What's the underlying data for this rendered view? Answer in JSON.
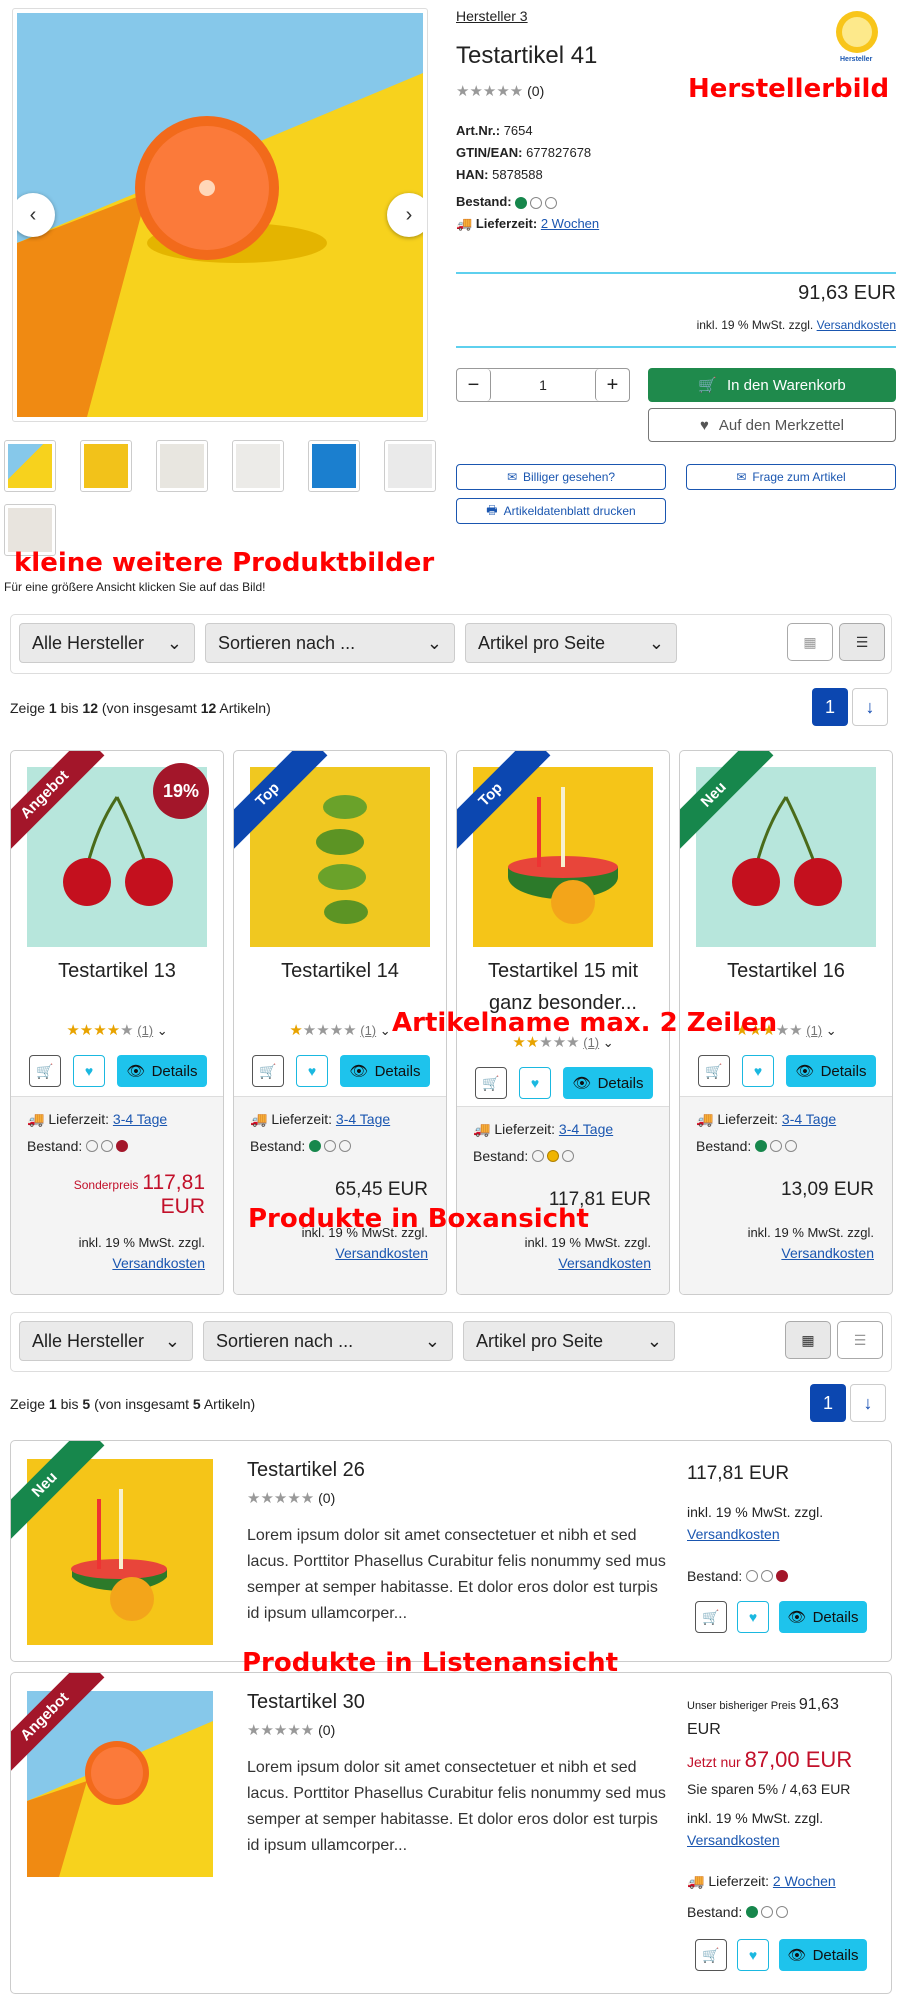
{
  "product": {
    "manufacturer_link": "Hersteller 3",
    "title": "Testartikel 41",
    "rating_count": "(0)",
    "art_nr_label": "Art.Nr.:",
    "art_nr": "7654",
    "gtin_label": "GTIN/EAN:",
    "gtin": "677827678",
    "han_label": "HAN:",
    "han": "5878588",
    "stock_label": "Bestand:",
    "delivery_label": "Lieferzeit:",
    "delivery_value": "2 Wochen",
    "price": "91,63 EUR",
    "tax_note": "inkl. 19 % MwSt. zzgl.",
    "shipping_link": "Versandkosten",
    "quantity": "1",
    "cart_button": "In den Warenkorb",
    "wishlist_button": "Auf den Merkzettel",
    "cheaper_button": "Billiger gesehen?",
    "question_button": "Frage zum Artikel",
    "datasheet_button": "Artikeldatenblatt drucken",
    "manufacturer_logo_text": "Hersteller",
    "enlarge_hint": "Für eine größere Ansicht klicken Sie auf das Bild!"
  },
  "annotations": {
    "manufacturer_image": "Herstellerbild",
    "more_images": "kleine weitere Produktbilder",
    "name_lines": "Artikelname max. 2 Zeilen",
    "box_view": "Produkte in Boxansicht",
    "list_view": "Produkte in Listenansicht"
  },
  "filters": {
    "manufacturer": "Alle Hersteller",
    "sort": "Sortieren nach ...",
    "per_page": "Artikel pro Seite"
  },
  "box_section": {
    "count_prefix": "Zeige ",
    "from": "1",
    "mid": " bis ",
    "to": "12",
    "suffix1": " (von insgesamt ",
    "total": "12",
    "suffix2": " Artikeln)",
    "page": "1"
  },
  "list_section": {
    "count_prefix": "Zeige ",
    "from": "1",
    "mid": " bis ",
    "to": "5",
    "suffix1": " (von insgesamt ",
    "total": "5",
    "suffix2": " Artikeln)",
    "page": "1"
  },
  "box_products": [
    {
      "name": "Testartikel 13",
      "ribbon": "Angebot",
      "badge": "19%",
      "rating_count": "(1)",
      "stars": 4,
      "delivery_label": "Lieferzeit:",
      "delivery": "3-4 Tage",
      "stock_label": "Bestand:",
      "stock": "red",
      "price_prefix": "Sonderpreis",
      "price": "117,81",
      "price_unit": "EUR",
      "tax": "inkl. 19 % MwSt. zzgl.",
      "shipping": "Versandkosten",
      "details": "Details"
    },
    {
      "name": "Testartikel 14",
      "ribbon": "Top",
      "rating_count": "(1)",
      "stars": 1,
      "delivery_label": "Lieferzeit:",
      "delivery": "3-4 Tage",
      "stock_label": "Bestand:",
      "stock": "green",
      "price": "65,45 EUR",
      "tax": "inkl. 19 % MwSt. zzgl.",
      "shipping": "Versandkosten",
      "details": "Details"
    },
    {
      "name": "Testartikel 15 mit ganz besonder...",
      "ribbon": "Top",
      "rating_count": "(1)",
      "stars": 2,
      "delivery_label": "Lieferzeit:",
      "delivery": "3-4 Tage",
      "stock_label": "Bestand:",
      "stock": "yellow",
      "price": "117,81 EUR",
      "tax": "inkl. 19 % MwSt. zzgl.",
      "shipping": "Versandkosten",
      "details": "Details"
    },
    {
      "name": "Testartikel 16",
      "ribbon": "Neu",
      "rating_count": "(1)",
      "stars": 3,
      "delivery_label": "Lieferzeit:",
      "delivery": "3-4 Tage",
      "stock_label": "Bestand:",
      "stock": "green",
      "price": "13,09 EUR",
      "tax": "inkl. 19 % MwSt. zzgl.",
      "shipping": "Versandkosten",
      "details": "Details"
    }
  ],
  "list_products": [
    {
      "name": "Testartikel 26",
      "ribbon": "Neu",
      "rating_count": "(0)",
      "description": "Lorem ipsum dolor sit amet consectetuer et nibh et sed lacus. Porttitor Phasellus Curabitur felis nonummy sed mus semper at semper habitasse. Et dolor eros dolor est turpis id ipsum ullamcorper...",
      "price": "117,81 EUR",
      "tax": "inkl. 19 % MwSt. zzgl.",
      "shipping": "Versandkosten",
      "stock_label": "Bestand:",
      "details": "Details"
    },
    {
      "name": "Testartikel 30",
      "ribbon": "Angebot",
      "rating_count": "(0)",
      "description": "Lorem ipsum dolor sit amet consectetuer et nibh et sed lacus. Porttitor Phasellus Curabitur felis nonummy sed mus semper at semper habitasse. Et dolor eros dolor est turpis id ipsum ullamcorper...",
      "old_price_label": "Unser bisheriger Preis",
      "old_price": "91,63",
      "old_price_unit": "EUR",
      "now_label": "Jetzt nur",
      "now_price": "87,00 EUR",
      "savings": "Sie sparen 5% / 4,63 EUR",
      "tax": "inkl. 19 % MwSt. zzgl.",
      "shipping": "Versandkosten",
      "delivery_label": "Lieferzeit:",
      "delivery": "2 Wochen",
      "stock_label": "Bestand:",
      "details": "Details"
    }
  ],
  "colors": {
    "primary": "#0c47b0",
    "cart_green": "#1f8a4c",
    "details_cyan": "#1ec3ec",
    "sale_red": "#a3162a",
    "annotation": "#ff0000"
  }
}
